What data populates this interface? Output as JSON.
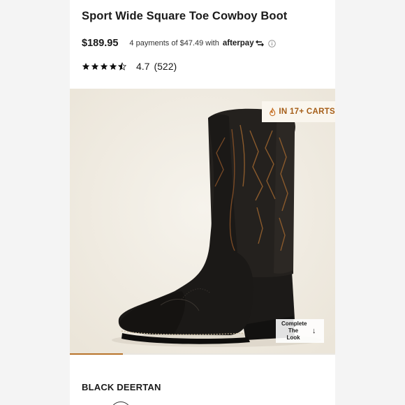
{
  "product": {
    "title": "Sport Wide Square Toe Cowboy Boot",
    "price": "$189.95",
    "installments": "4 payments of $47.49",
    "with": "with",
    "afterpay": "afterpay",
    "rating": {
      "value": "4.7",
      "count": "(522)",
      "stars_filled": 4.5,
      "stars_total": 5
    }
  },
  "gallery": {
    "badge": {
      "icon": "flame-icon",
      "text": "IN 17+ CARTS",
      "color": "#a55d17"
    },
    "complete_look": {
      "label": "Complete\nThe Look",
      "icon": "arrow-down-icon"
    },
    "progress": 0.2,
    "accent": "#b8732a"
  },
  "color": {
    "name": "BLACK DEERTAN"
  }
}
